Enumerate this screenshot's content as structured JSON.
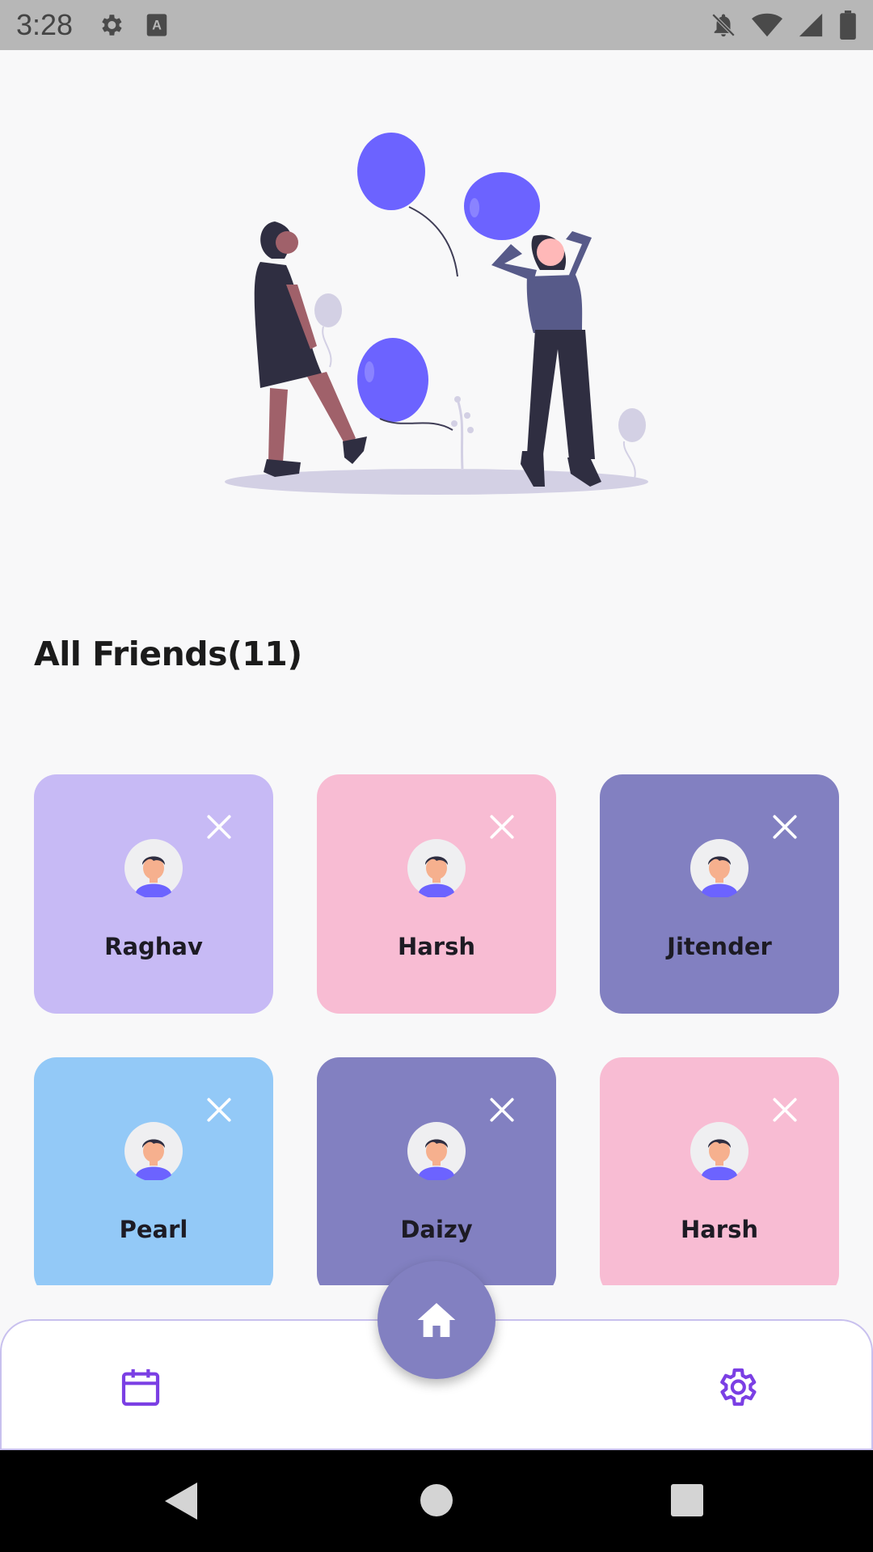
{
  "status_bar": {
    "time": "3:28",
    "left_icons": [
      "settings-icon",
      "keyboard-a-icon"
    ],
    "right_icons": [
      "bell-off-icon",
      "wifi-icon",
      "signal-icon",
      "battery-icon"
    ]
  },
  "illustration": {
    "name": "friends-with-balloons-illustration",
    "accent_color": "#6c63ff"
  },
  "friends_section": {
    "title": "All Friends(11)"
  },
  "friends": [
    {
      "name": "Raghav",
      "color": "#c7baf5"
    },
    {
      "name": "Harsh",
      "color": "#f8bcd3"
    },
    {
      "name": "Jitender",
      "color": "#8280c1"
    },
    {
      "name": "Pearl",
      "color": "#93c9f7"
    },
    {
      "name": "Daizy",
      "color": "#8280c1"
    },
    {
      "name": "Harsh",
      "color": "#f8bcd3"
    }
  ],
  "bottom_nav": {
    "items": [
      "calendar-icon",
      "home-icon",
      "settings-icon"
    ],
    "accent_color": "#7b3fe4",
    "fab_color": "#8280c1"
  },
  "system_nav": [
    "back-icon",
    "home-circle-icon",
    "recents-icon"
  ]
}
